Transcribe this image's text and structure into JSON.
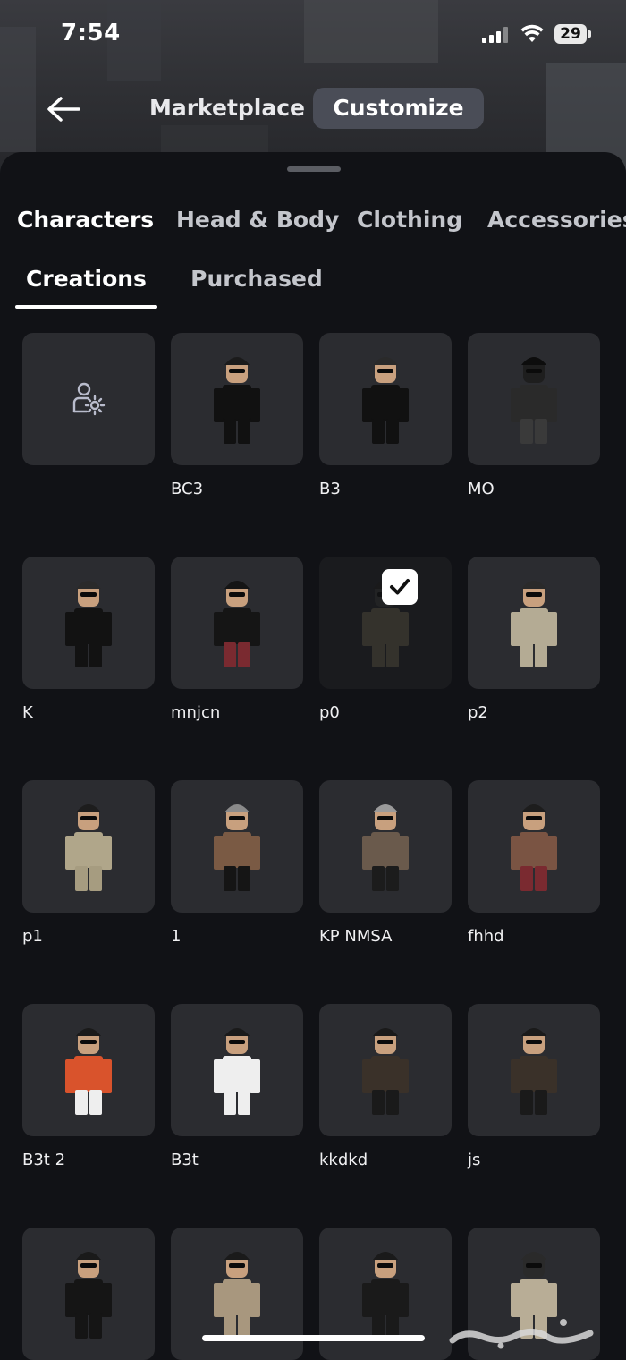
{
  "status_bar": {
    "time": "7:54",
    "battery": "29"
  },
  "nav": {
    "marketplace": "Marketplace",
    "customize": "Customize"
  },
  "category_tabs": [
    "Characters",
    "Head & Body",
    "Clothing",
    "Accessories"
  ],
  "sub_tabs": [
    "Creations",
    "Purchased"
  ],
  "grid": {
    "items": [
      {
        "label": "",
        "icon": "create-character-icon"
      },
      {
        "label": "BC3",
        "shirt": "#111111",
        "pants": "#111111",
        "hat": "#1b1b1b",
        "skin": "#c8a07e"
      },
      {
        "label": "B3",
        "shirt": "#111111",
        "pants": "#111111",
        "hat": "#2a2a2a",
        "skin": "#c8a07e"
      },
      {
        "label": "MO",
        "shirt": "#2a2a2a",
        "pants": "#3a3a3a",
        "hat": "#0d0d0d",
        "skin": "#1e1e1e"
      },
      {
        "label": "K",
        "shirt": "#121212",
        "pants": "#121212",
        "hat": "#2a2a2a",
        "skin": "#c8a07e"
      },
      {
        "label": "mnjcn",
        "shirt": "#151515",
        "pants": "#7a2a30",
        "hat": "#151515",
        "skin": "#c8a07e"
      },
      {
        "label": "p0",
        "shirt": "#4a4538",
        "pants": "#4a4538",
        "hat": "#1a1a1a",
        "skin": "#2a2a2a",
        "selected": true
      },
      {
        "label": "p2",
        "shirt": "#b4ab94",
        "pants": "#b4ab94",
        "hat": "#2a2a2a",
        "skin": "#c8a07e"
      },
      {
        "label": "p1",
        "shirt": "#b0a68a",
        "pants": "#a69c80",
        "hat": "#1d1d1d",
        "skin": "#c8a07e"
      },
      {
        "label": "1",
        "shirt": "#7a5a44",
        "pants": "#151515",
        "hat": "#8a8a8a",
        "skin": "#c8a07e"
      },
      {
        "label": "KP NMSA",
        "shirt": "#6a5a4c",
        "pants": "#1c1c1c",
        "hat": "#9a9a9a",
        "skin": "#c8a07e"
      },
      {
        "label": "fhhd",
        "shirt": "#7a5443",
        "pants": "#7a2a30",
        "hat": "#1d1d1d",
        "skin": "#c8a07e"
      },
      {
        "label": "B3t 2",
        "shirt": "#d9532c",
        "pants": "#eeeeee",
        "hat": "#1a1a1a",
        "skin": "#c8a07e"
      },
      {
        "label": "B3t",
        "shirt": "#eeeeee",
        "pants": "#eeeeee",
        "hat": "#1a1a1a",
        "skin": "#c8a07e"
      },
      {
        "label": "kkdkd",
        "shirt": "#3a3129",
        "pants": "#1a1a1a",
        "hat": "#1a1a1a",
        "skin": "#c8a07e"
      },
      {
        "label": "js",
        "shirt": "#3a3129",
        "pants": "#1a1a1a",
        "hat": "#1a1a1a",
        "skin": "#c8a07e"
      },
      {
        "label": "",
        "shirt": "#151515",
        "pants": "#151515",
        "hat": "#1a1a1a",
        "skin": "#c8a07e"
      },
      {
        "label": "",
        "shirt": "#a8977e",
        "pants": "#a8977e",
        "hat": "#1a1a1a",
        "skin": "#c8a07e"
      },
      {
        "label": "",
        "shirt": "#1a1a1a",
        "pants": "#1a1a1a",
        "hat": "#1a1a1a",
        "skin": "#c8a07e"
      },
      {
        "label": "",
        "shirt": "#b8ad96",
        "pants": "#b8ad96",
        "hat": "#2a2a2a",
        "skin": "#2a2a2a"
      }
    ]
  },
  "watermark": "حراج"
}
